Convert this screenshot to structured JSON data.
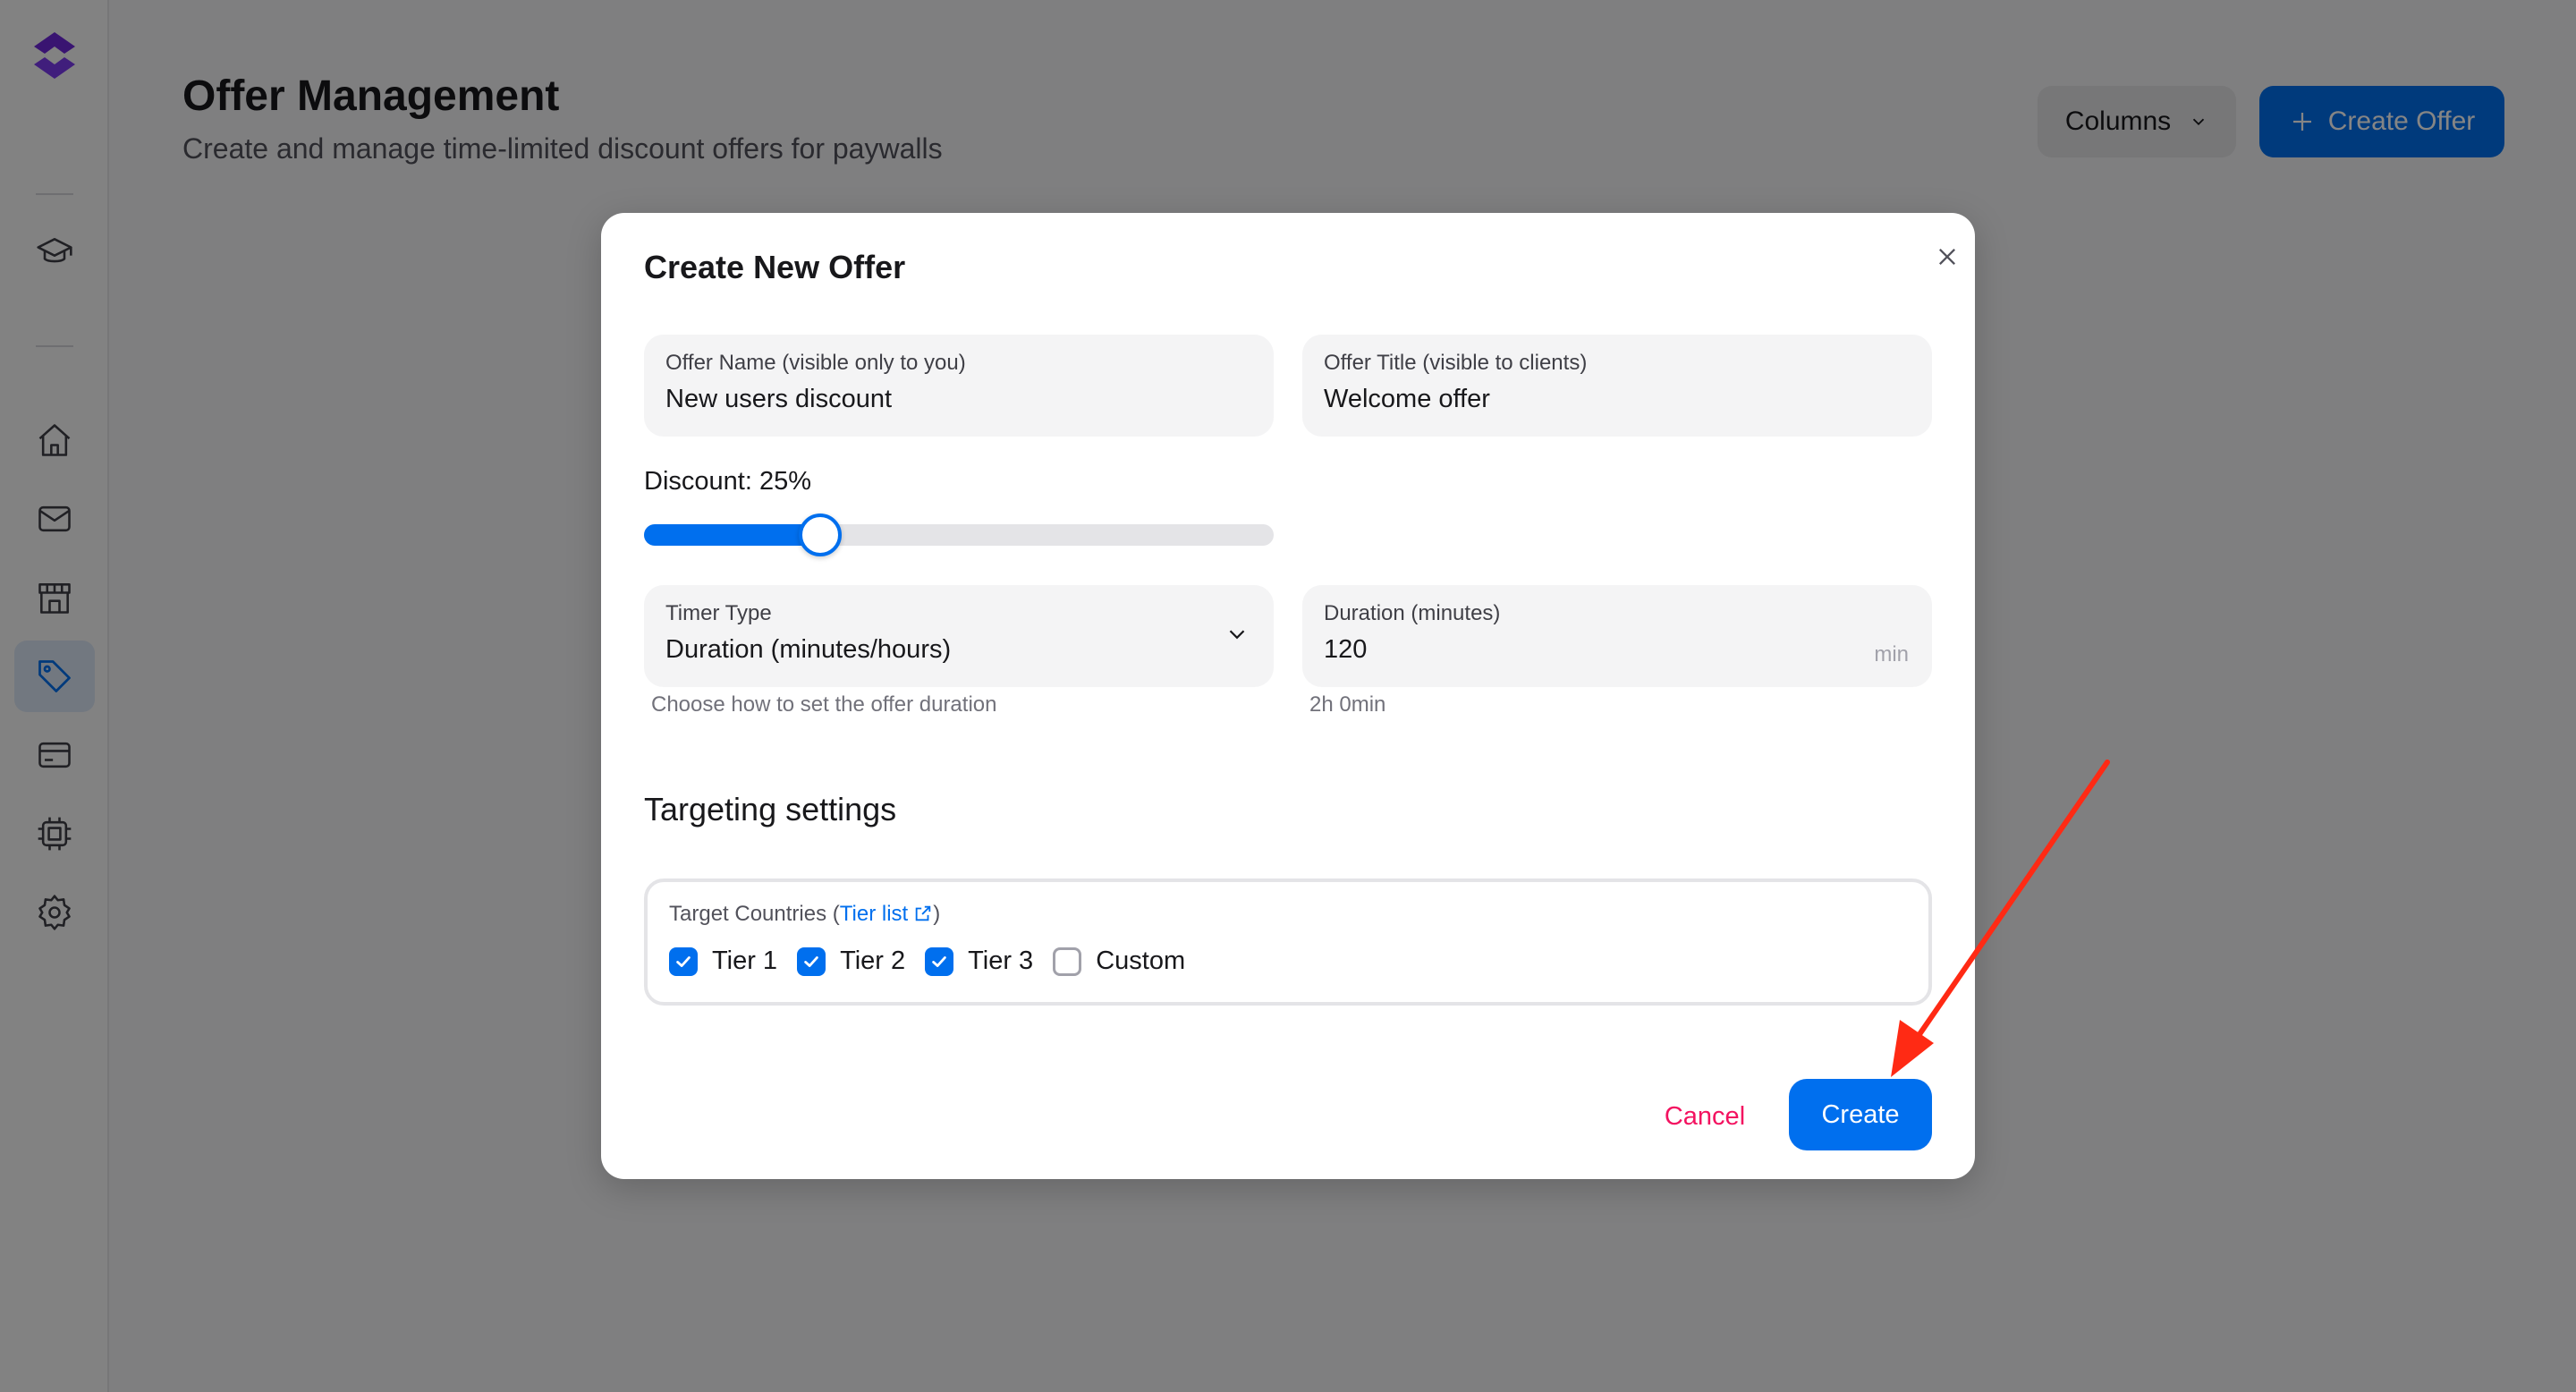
{
  "colors": {
    "accent": "#006fee",
    "danger": "#f31260",
    "annotation_arrow": "#ff2a14"
  },
  "sidebar": {
    "items": [
      {
        "icon": "graduation-cap-icon"
      },
      {
        "icon": "home-icon"
      },
      {
        "icon": "mail-icon"
      },
      {
        "icon": "store-icon"
      },
      {
        "icon": "tag-icon",
        "active": true
      },
      {
        "icon": "credit-card-icon"
      },
      {
        "icon": "chip-icon"
      },
      {
        "icon": "gear-icon"
      }
    ]
  },
  "header": {
    "title": "Offer Management",
    "subtitle": "Create and manage time-limited discount offers for paywalls",
    "columns_label": "Columns",
    "create_offer_label": "Create Offer"
  },
  "modal": {
    "title": "Create New Offer",
    "offer_name": {
      "label": "Offer Name (visible only to you)",
      "value": "New users discount"
    },
    "offer_title": {
      "label": "Offer Title (visible to clients)",
      "value": "Welcome offer"
    },
    "discount": {
      "label": "Discount: 25%",
      "value_percent": 25
    },
    "timer_type": {
      "label": "Timer Type",
      "value": "Duration (minutes/hours)",
      "helper": "Choose how to set the offer duration"
    },
    "duration": {
      "label": "Duration (minutes)",
      "value": "120",
      "suffix": "min",
      "helper": "2h 0min"
    },
    "targeting": {
      "section_title": "Targeting settings",
      "countries_label_prefix": "Target Countries (",
      "tier_list_link": "Tier list",
      "countries_label_suffix": ")",
      "options": [
        {
          "label": "Tier 1",
          "checked": true
        },
        {
          "label": "Tier 2",
          "checked": true
        },
        {
          "label": "Tier 3",
          "checked": true
        },
        {
          "label": "Custom",
          "checked": false
        }
      ]
    },
    "cancel_label": "Cancel",
    "create_label": "Create"
  }
}
